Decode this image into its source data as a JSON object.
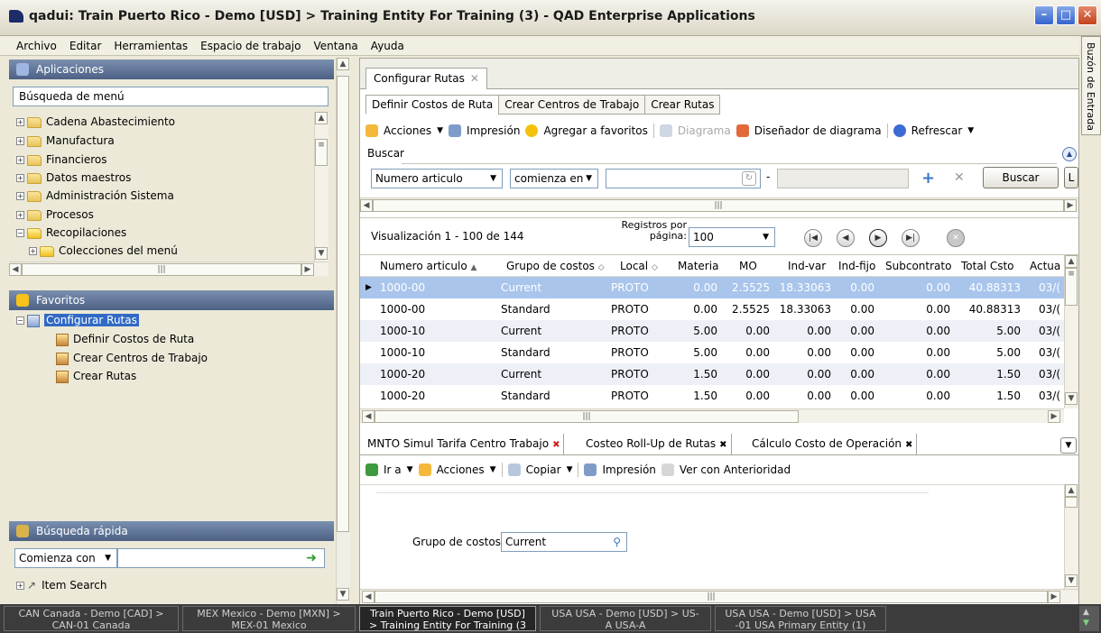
{
  "window": {
    "title": "qadui: Train Puerto Rico - Demo [USD] > Training Entity For Training (3) - QAD Enterprise Applications"
  },
  "menu": [
    "Archivo",
    "Editar",
    "Herramientas",
    "Espacio de trabajo",
    "Ventana",
    "Ayuda"
  ],
  "right_tab": "Buzón de Entrada",
  "left": {
    "apps_header": "Aplicaciones",
    "menu_search_placeholder": "Búsqueda de menú",
    "tree": [
      "Cadena Abastecimiento",
      "Manufactura",
      "Financieros",
      "Datos maestros",
      "Administración Sistema",
      "Procesos",
      "Recopilaciones",
      "Colecciones del menú"
    ],
    "favorites_header": "Favoritos",
    "favorites": {
      "root": "Configurar Rutas",
      "children": [
        "Definir Costos de Ruta",
        "Crear Centros de Trabajo",
        "Crear Rutas"
      ]
    },
    "quick_header": "Búsqueda rápida",
    "quick_mode": "Comienza con",
    "quick_item": "Item Search"
  },
  "main": {
    "doc_tab": "Configurar Rutas",
    "subtabs": [
      "Definir Costos de Ruta",
      "Crear Centros de Trabajo",
      "Crear Rutas"
    ],
    "toolbar": {
      "acciones": "Acciones",
      "impresion": "Impresión",
      "favoritos": "Agregar a favoritos",
      "diagrama": "Diagrama",
      "disenador": "Diseñador de diagrama",
      "refrescar": "Refrescar"
    },
    "search": {
      "label": "Buscar",
      "field": "Numero articulo",
      "operator": "comienza en",
      "dash": "-",
      "button": "Buscar"
    },
    "pager": {
      "display": "Visualización  1 - 100  de  144",
      "per_page_label_1": "Registros por",
      "per_page_label_2": "página:",
      "per_page": "100"
    },
    "grid": {
      "columns": [
        "Numero articulo",
        "Grupo de costos",
        "Local",
        "Material",
        "MO",
        "Ind-var",
        "Ind-fijo",
        "Subcontrato",
        "Total Csto",
        "Actua"
      ],
      "rows": [
        [
          "1000-00",
          "Current",
          "PROTO",
          "0.00",
          "2.5525",
          "18.33063",
          "0.00",
          "0.00",
          "40.88313",
          "03/("
        ],
        [
          "1000-00",
          "Standard",
          "PROTO",
          "0.00",
          "2.5525",
          "18.33063",
          "0.00",
          "0.00",
          "40.88313",
          "03/("
        ],
        [
          "1000-10",
          "Current",
          "PROTO",
          "5.00",
          "0.00",
          "0.00",
          "0.00",
          "0.00",
          "5.00",
          "03/("
        ],
        [
          "1000-10",
          "Standard",
          "PROTO",
          "5.00",
          "0.00",
          "0.00",
          "0.00",
          "0.00",
          "5.00",
          "03/("
        ],
        [
          "1000-20",
          "Current",
          "PROTO",
          "1.50",
          "0.00",
          "0.00",
          "0.00",
          "0.00",
          "1.50",
          "03/("
        ],
        [
          "1000-20",
          "Standard",
          "PROTO",
          "1.50",
          "0.00",
          "0.00",
          "0.00",
          "0.00",
          "1.50",
          "03/("
        ]
      ]
    },
    "bottom_tabs": [
      "MNTO Simul Tarifa Centro Trabajo",
      "Costeo Roll-Up de Rutas",
      "Cálculo Costo de Operación"
    ],
    "bottom_toolbar": {
      "ira": "Ir a",
      "acciones": "Acciones",
      "copiar": "Copiar",
      "impresion": "Impresión",
      "ver": "Ver con Anterioridad"
    },
    "form": {
      "label": "Grupo de costos:",
      "value": "Current"
    }
  },
  "taskbar": [
    {
      "line1": "CAN Canada - Demo [CAD] >",
      "line2": "CAN-01 Canada"
    },
    {
      "line1": "MEX Mexico - Demo [MXN] >",
      "line2": "MEX-01 Mexico"
    },
    {
      "line1": "Train Puerto Rico - Demo [USD]",
      "line2": "> Training Entity For Training (3"
    },
    {
      "line1": "USA USA - Demo [USD] > US-",
      "line2": "A USA-A"
    },
    {
      "line1": "USA USA - Demo [USD] > USA",
      "line2": "-01 USA Primary Entity (1)"
    }
  ],
  "colors": {
    "selection": "#316ac5",
    "selected_row": "#a9c5ec",
    "header_grad": "#4d6185",
    "taskbar": "#3c3c3c"
  }
}
